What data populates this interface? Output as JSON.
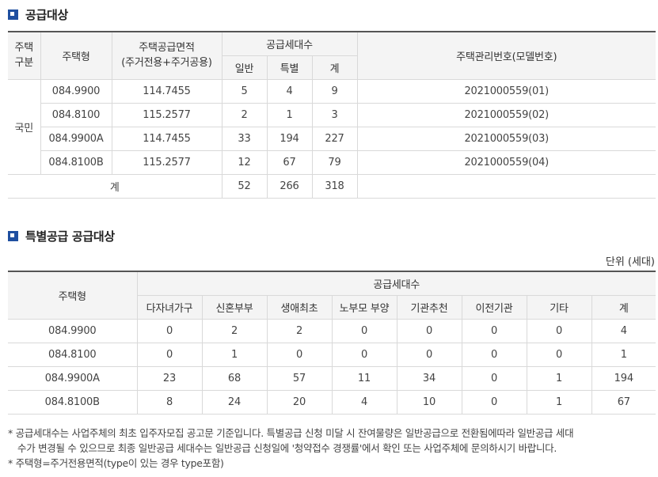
{
  "section1": {
    "title": "공급대상",
    "headers": {
      "type_group": "주택\n구분",
      "house_type": "주택형",
      "area": "주택공급면적\n(주거전용+주거공용)",
      "units": "공급세대수",
      "general": "일반",
      "special": "특별",
      "total": "계",
      "mgmt_no": "주택관리번호(모델번호)"
    },
    "group_label": "국민",
    "rows": [
      {
        "type": "084.9900",
        "area": "114.7455",
        "general": "5",
        "special": "4",
        "total": "9",
        "mgmt": "2021000559(01)"
      },
      {
        "type": "084.8100",
        "area": "115.2577",
        "general": "2",
        "special": "1",
        "total": "3",
        "mgmt": "2021000559(02)"
      },
      {
        "type": "084.9900A",
        "area": "114.7455",
        "general": "33",
        "special": "194",
        "total": "227",
        "mgmt": "2021000559(03)"
      },
      {
        "type": "084.8100B",
        "area": "115.2577",
        "general": "12",
        "special": "67",
        "total": "79",
        "mgmt": "2021000559(04)"
      }
    ],
    "sum": {
      "label": "계",
      "general": "52",
      "special": "266",
      "total": "318"
    }
  },
  "section2": {
    "title": "특별공급 공급대상",
    "unit_label": "단위 (세대)",
    "headers": {
      "house_type": "주택형",
      "units": "공급세대수",
      "cols": [
        "다자녀가구",
        "신혼부부",
        "생애최초",
        "노부모 부양",
        "기관추천",
        "이전기관",
        "기타",
        "계"
      ]
    },
    "rows": [
      {
        "type": "084.9900",
        "vals": [
          "0",
          "2",
          "2",
          "0",
          "0",
          "0",
          "0",
          "4"
        ]
      },
      {
        "type": "084.8100",
        "vals": [
          "0",
          "1",
          "0",
          "0",
          "0",
          "0",
          "0",
          "1"
        ]
      },
      {
        "type": "084.9900A",
        "vals": [
          "23",
          "68",
          "57",
          "11",
          "34",
          "0",
          "1",
          "194"
        ]
      },
      {
        "type": "084.8100B",
        "vals": [
          "8",
          "24",
          "20",
          "4",
          "10",
          "0",
          "1",
          "67"
        ]
      }
    ]
  },
  "notes": {
    "line1": "* 공급세대수는 사업주체의 최초 입주자모집 공고문 기준입니다. 특별공급 신청 미달 시 잔여물량은 일반공급으로 전환됨에따라 일반공급 세대",
    "line2": "수가 변경될 수 있으므로 최종 일반공급 세대수는 일반공급 신청일에 '청약접수 경쟁률'에서 확인 또는 사업주체에 문의하시기 바랍니다.",
    "line3": "* 주택형=주거전용면적(type이 있는 경우 type포함)"
  },
  "colors": {
    "accent": "#1f4fa0",
    "header_bg": "#f4f4f4",
    "border": "#d9d9d9"
  }
}
